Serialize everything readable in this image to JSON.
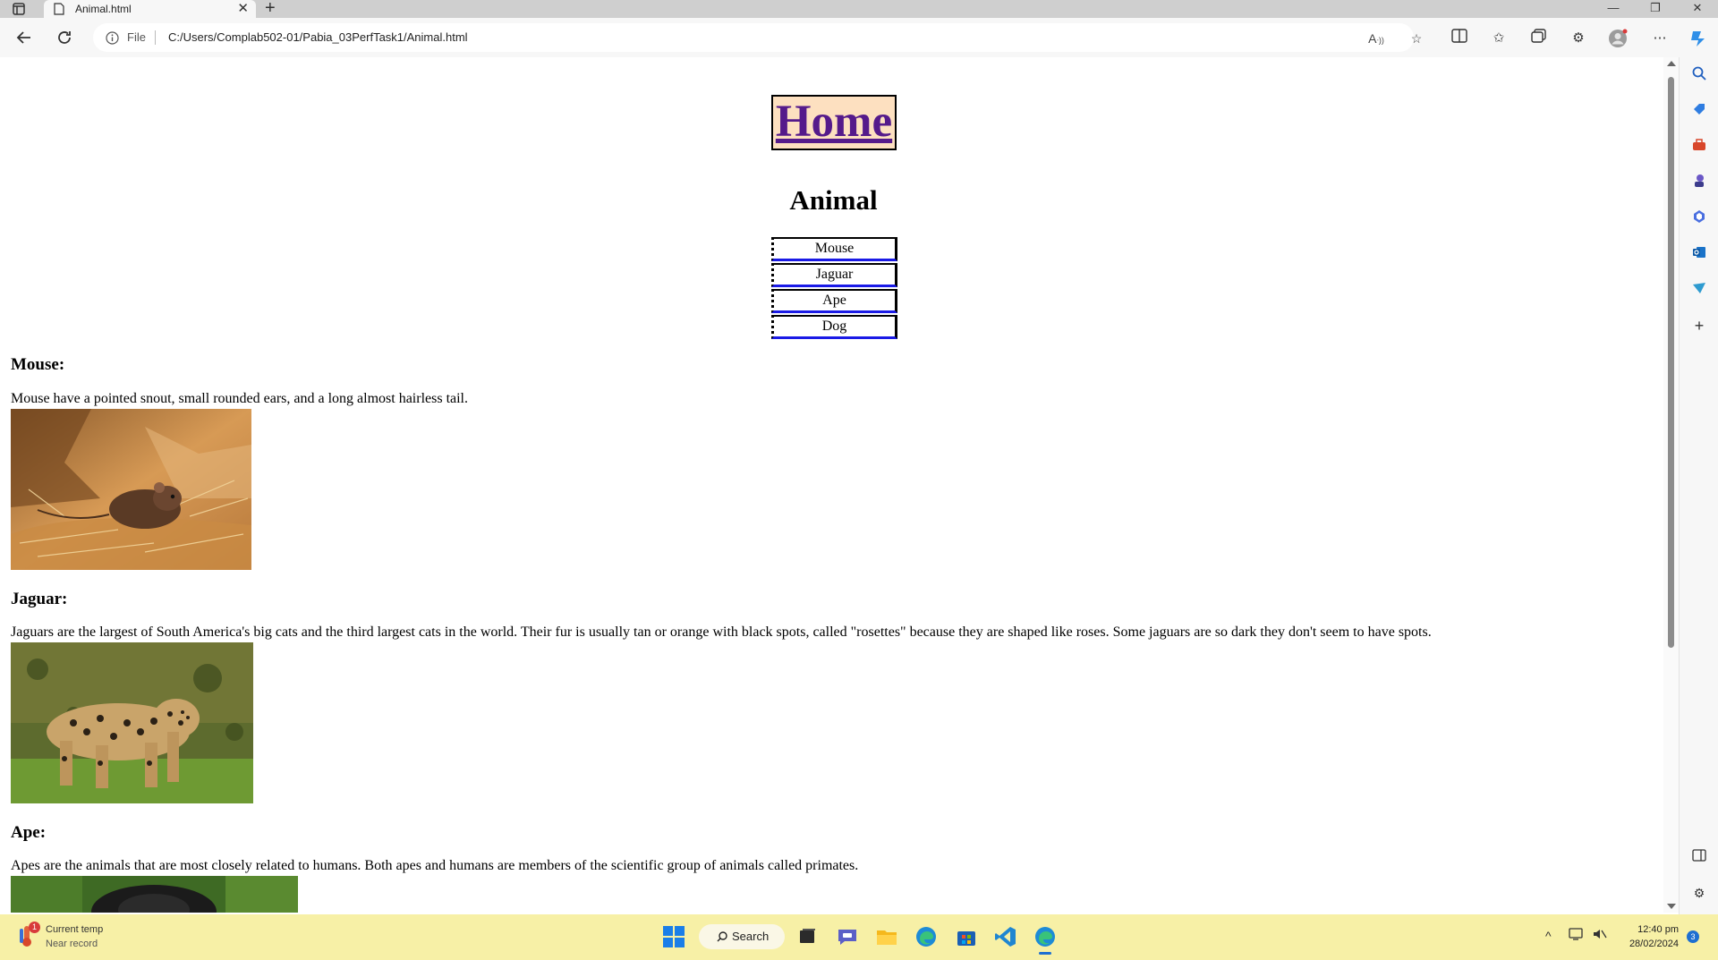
{
  "browser": {
    "tab_title": "Animal.html",
    "address_prefix": "File",
    "url": "C:/Users/Complab502-01/Pabia_03PerfTask1/Animal.html"
  },
  "page": {
    "home_link": "Home",
    "heading": "Animal",
    "nav_items": [
      "Mouse",
      "Jaguar",
      "Ape",
      "Dog"
    ],
    "sections": [
      {
        "title": "Mouse:",
        "description": "Mouse have a pointed snout, small rounded ears, and a long almost hairless tail."
      },
      {
        "title": "Jaguar:",
        "description": "Jaguars are the largest of South America's big cats and the third largest cats in the world. Their fur is usually tan or orange with black spots, called \"rosettes\" because they are shaped like roses. Some jaguars are so dark they don't seem to have spots."
      },
      {
        "title": "Ape:",
        "description": "Apes are the animals that are most closely related to humans. Both apes and humans are members of the scientific group of animals called primates."
      }
    ]
  },
  "taskbar": {
    "weather_line1": "Current temp",
    "weather_line2": "Near record",
    "weather_badge": "1",
    "search_label": "Search",
    "time": "12:40 pm",
    "date": "28/02/2024",
    "notification_count": "3"
  },
  "icons": [
    "page-icon",
    "back-icon",
    "refresh-icon",
    "info-icon",
    "read-aloud-icon",
    "favorite-icon",
    "split-screen-icon",
    "favorites-icon",
    "collections-icon",
    "extensions-icon",
    "profile-icon",
    "more-icon",
    "copilot-icon"
  ]
}
